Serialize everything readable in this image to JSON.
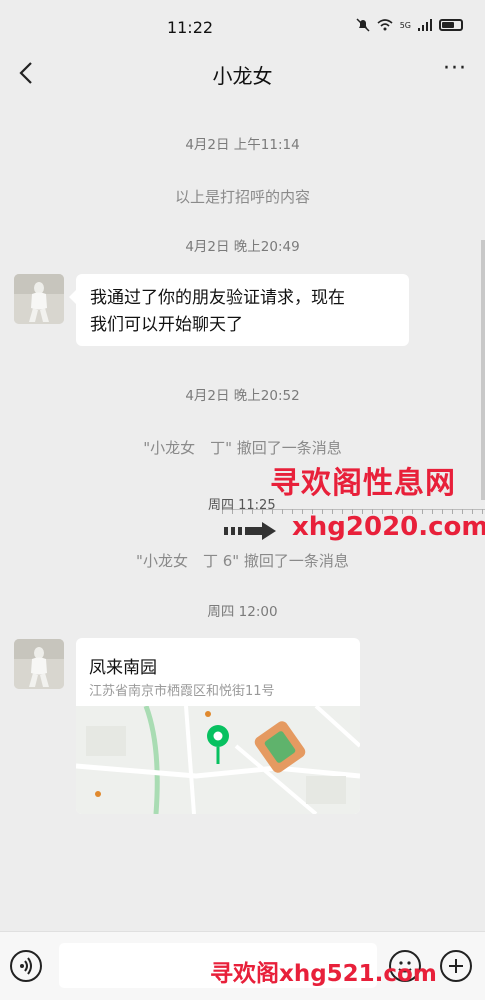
{
  "status_bar": {
    "time": "11:22",
    "icons": [
      "mute-bell-icon",
      "wifi-icon",
      "5g-signal-icon",
      "battery-icon"
    ],
    "network_label": "5G"
  },
  "header": {
    "title": "小龙女",
    "back_icon": "chevron-left-icon",
    "more_label": "···"
  },
  "messages": {
    "ts1": "4月2日 上午11:14",
    "greeting_note": "以上是打招呼的内容",
    "ts2": "4月2日 晚上20:49",
    "bubble1_line1": "我通过了你的朋友验证请求，现在",
    "bubble1_line2": "我们可以开始聊天了",
    "ts3": "4月2日 晚上20:52",
    "recall1": "\"小龙女　丁\" 撤回了一条消息",
    "ts4": "周四 11:25",
    "recall2": "\"小龙女　丁 6\" 撤回了一条消息",
    "ts5": "周四 12:00"
  },
  "location": {
    "name": "凤来南园",
    "address": "江苏省南京市栖霞区和悦街11号"
  },
  "watermarks": {
    "cn_site": "寻欢阁性息网",
    "domain1": "xhg2020.com",
    "bottom": "寻欢阁xhg521.com"
  },
  "colors": {
    "background": "#ededed",
    "bubble": "#ffffff",
    "watermark": "#e8203a",
    "pin": "#07c160"
  }
}
